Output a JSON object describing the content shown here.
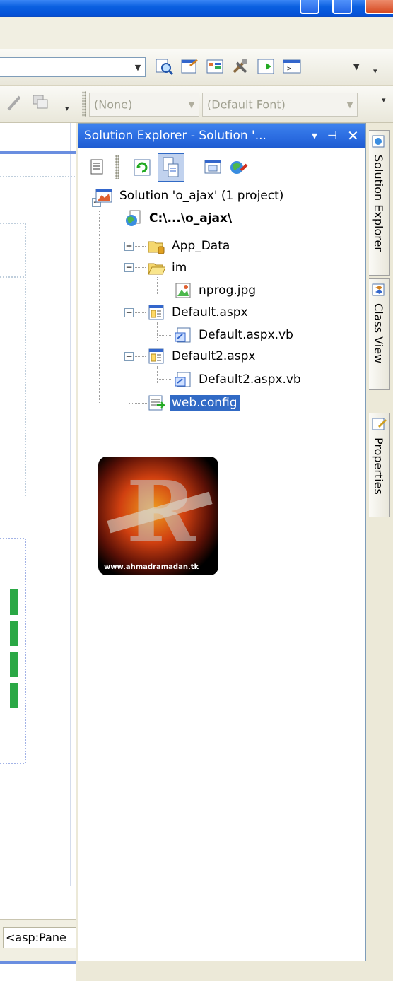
{
  "toolbar2": {
    "style_combo": "(None)",
    "font_combo": "(Default Font)"
  },
  "solution_explorer": {
    "title": "Solution Explorer - Solution '...",
    "tree": [
      {
        "label": "Solution 'o_ajax' (1 project)",
        "icon": "solution-icon"
      },
      {
        "label": "C:\\...\\o_ajax\\",
        "icon": "web-project-icon",
        "bold": true
      },
      {
        "label": "App_Data",
        "icon": "folder-icon"
      },
      {
        "label": "im",
        "icon": "open-folder-icon"
      },
      {
        "label": "nprog.jpg",
        "icon": "image-file-icon"
      },
      {
        "label": "Default.aspx",
        "icon": "aspx-file-icon"
      },
      {
        "label": "Default.aspx.vb",
        "icon": "vb-file-icon"
      },
      {
        "label": "Default2.aspx",
        "icon": "aspx-file-icon"
      },
      {
        "label": "Default2.aspx.vb",
        "icon": "vb-file-icon"
      },
      {
        "label": "web.config",
        "icon": "config-file-icon",
        "selected": true
      }
    ]
  },
  "logo": {
    "text": "www.ahmadramadan.tk"
  },
  "dock_tabs": [
    {
      "label": "Solution Explorer",
      "icon": "solution-explorer-icon"
    },
    {
      "label": "Class View",
      "icon": "class-view-icon"
    },
    {
      "label": "Properties",
      "icon": "properties-icon"
    }
  ],
  "editor": {
    "tag_chip": "<asp:Pane"
  },
  "colors": {
    "selection": "#316ac5",
    "title_blue": "#2a6be0",
    "panel_border": "#7f9db9"
  }
}
